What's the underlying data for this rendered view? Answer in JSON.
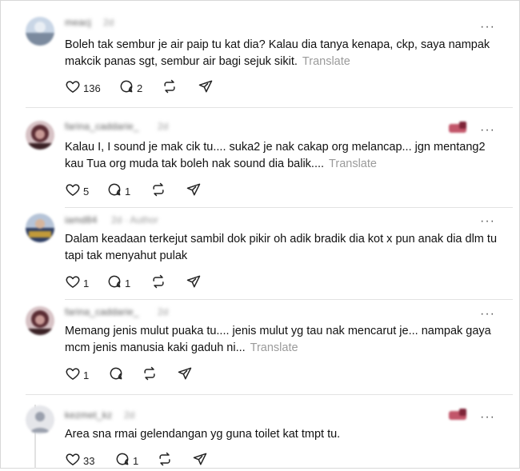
{
  "translate_label": "Translate",
  "more_glyph": "···",
  "comments": [
    {
      "username": "meacj",
      "time": "2d",
      "text": "Boleh tak sembur je air paip tu kat dia? Kalau dia tanya kenapa, ckp, saya nampak makcik panas sgt, sembur air bagi sejuk sikit.",
      "likes": "136",
      "replies": "2"
    },
    {
      "username": "farina_caddarie_",
      "time": "2d",
      "text": "Kalau I, I sound je mak cik tu.... suka2 je nak cakap org melancap... jgn mentang2 kau Tua org muda tak boleh nak sound dia balik....",
      "likes": "5",
      "replies": "1"
    },
    {
      "username": "iamd84",
      "time": "2d · Author",
      "text": "Dalam keadaan terkejut sambil dok pikir oh adik bradik dia kot x pun anak dia dlm tu tapi tak menyahut pulak",
      "likes": "1",
      "replies": "1"
    },
    {
      "username": "farina_caddarie_",
      "time": "2d",
      "text": "Memang jenis mulut puaka tu.... jenis mulut yg tau nak mencarut je... nampak gaya mcm jenis manusia kaki gaduh ni...",
      "likes": "1",
      "replies": ""
    },
    {
      "username": "kezmet_kz",
      "time": "2d",
      "text": "Area sna rmai gelendangan yg guna toilet kat tmpt tu.",
      "likes": "33",
      "replies": "1"
    }
  ]
}
